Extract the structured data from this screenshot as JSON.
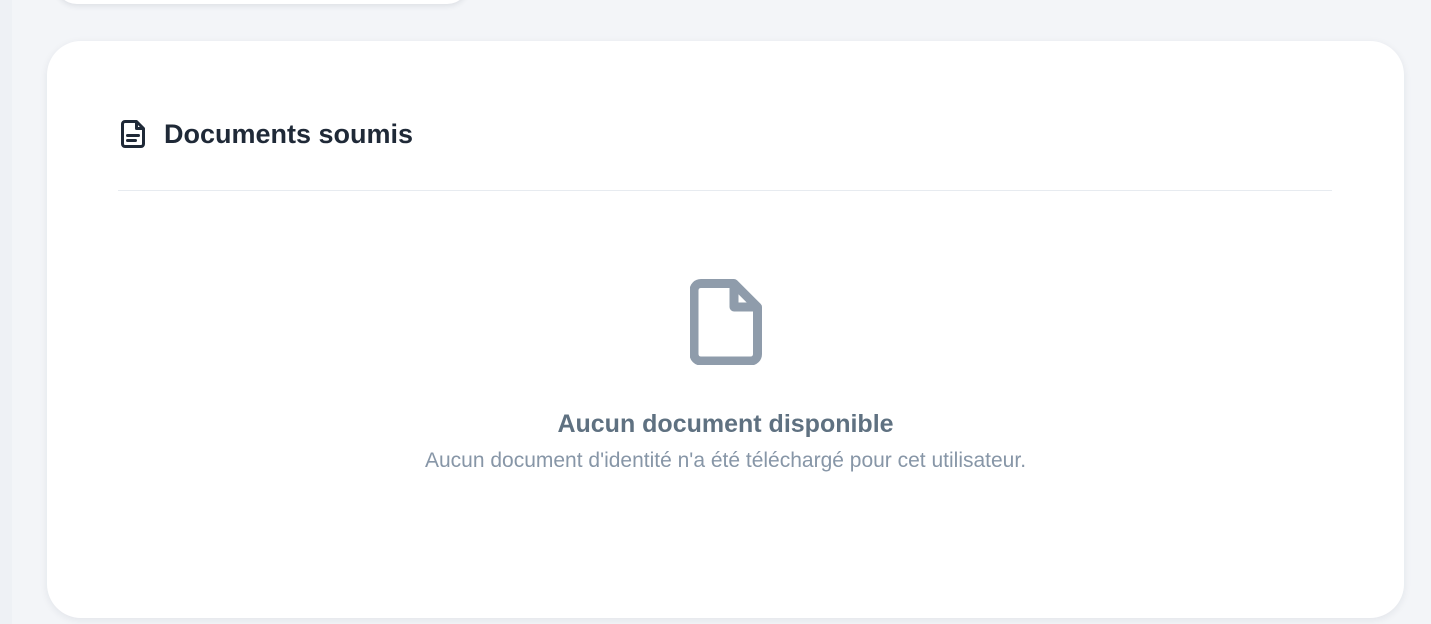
{
  "documents_panel": {
    "title": "Documents soumis",
    "title_icon": "file-text-icon",
    "empty_state": {
      "icon": "file-icon",
      "title": "Aucun document disponible",
      "message": "Aucun document d'identité n'a été téléchargé pour cet utilisateur."
    }
  },
  "colors": {
    "page_background": "#f3f5f8",
    "card_background": "#ffffff",
    "title_text": "#1f2937",
    "empty_icon": "#8f9cab",
    "empty_title": "#5f7181",
    "empty_message": "#8796a7",
    "divider": "#e7ebf0"
  }
}
